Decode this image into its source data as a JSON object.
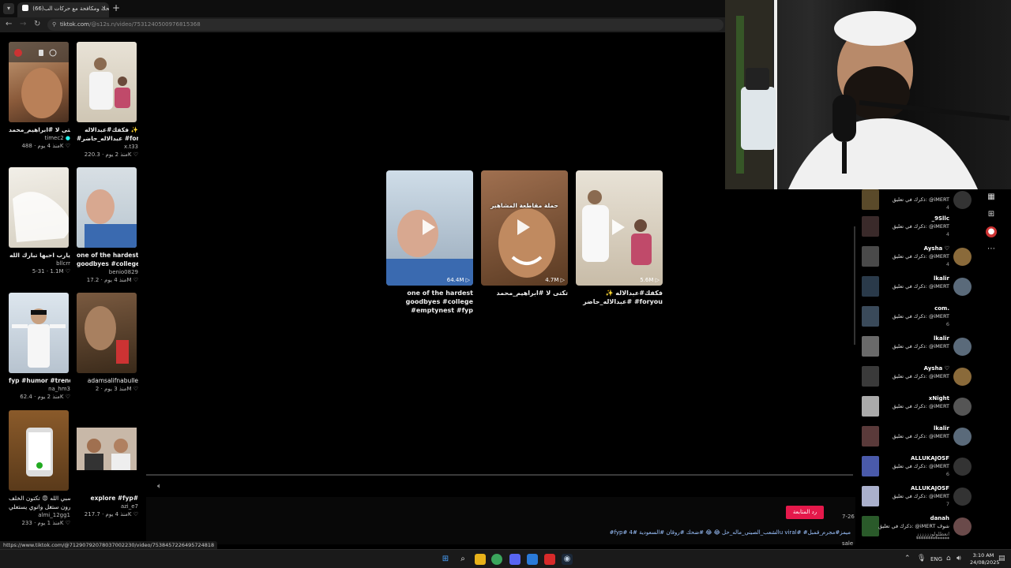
{
  "browser": {
    "tab_title": "(66)الضحك ومكافحة مع حركات الب",
    "tab_close": "×",
    "new_tab": "+",
    "url_domain": "tiktok.com",
    "url_path": "/@s12s.n/video/7531240500976815368",
    "status_url": "https://www.tiktok.com/@71290792078037002230/video/7538457226495724818"
  },
  "left_grid": [
    {
      "caption": "تكتى لا #ابراهيم_محمد",
      "user": "timec2",
      "views": "488K",
      "date": "منذ 4 يوم"
    },
    {
      "caption": "فكفك#عبدالاله ✨",
      "caption2": "#عبدالاله_حاضر #foryou",
      "user": "x.t33",
      "views": "220.3K",
      "date": "منذ 2 يوم"
    },
    {
      "caption": "يارب احبها تبارك الله",
      "user": "bllcrr",
      "views": "1.1M",
      "date": "5-31"
    },
    {
      "caption": "one of the hardest",
      "caption2": "goodbyes #college...",
      "user": "benio0829",
      "views": "17.2M",
      "date": "منذ 4 يوم"
    },
    {
      "caption": "fyp #humor #trend#",
      "user": "na_hm3",
      "views": "62.4K",
      "date": "منذ 2 يوم"
    },
    {
      "caption": "adamsalifnabulle",
      "user": "",
      "views": "2M",
      "date": "منذ 3 يوم"
    },
    {
      "caption": "حسبي الله 😡 تكتون الخلف",
      "caption2": "يحرون ستغل واتوي يستعلي",
      "user": "almi_12gg1",
      "views": "233K",
      "date": "منذ 1 يوم"
    },
    {
      "caption": "explore #fyp#",
      "user": "azi_e7",
      "views": "217.7K",
      "date": "منذ 4 يوم"
    }
  ],
  "related_videos": [
    {
      "caption": "one of the hardest goodbyes #college #emptynest #fyp",
      "views": "64.4M"
    },
    {
      "caption": "تكتى لا #ابراهيم_محمد",
      "views": "4.7M"
    },
    {
      "caption": "فكفك#عبدالاله ✨ #عبدالاله_حاضر #foryou",
      "views": "5.6M"
    }
  ],
  "thumb_overlays": {
    "meme": "حملة مقاطعة المشاهير"
  },
  "video_footer": {
    "reply_button": "رد المتابعة",
    "time": "7-26",
    "hashtags": "#fyp# الشعب_الصيني_ماله_حل 😂 😂 #ضحك #روقان #السعودية #4u viral# #ميمز#مجرم_قمبل",
    "sale": "sale"
  },
  "notifications": [
    {
      "name": "",
      "text": "ذكرك في تعليق: @iMERT",
      "time": "4",
      "thumb": "#5a4a2a",
      "avatar": "#333"
    },
    {
      "name": "_9Sllc",
      "text": "ذكرك في تعليق: @iMERT",
      "time": "4",
      "thumb": "#3a2a2a",
      "avatar": ""
    },
    {
      "name": "Aysha ♡",
      "text": "ذكرك في تعليق: @iMERT",
      "time": "4",
      "thumb": "#4a4a4a",
      "avatar": "#8a6a3a"
    },
    {
      "name": "lkalir",
      "text": "ذكرك في تعليق: @iMERT",
      "time": "6",
      "thumb": "#2a3a4a",
      "avatar": "#5a6a7a"
    },
    {
      "name": "com.",
      "text": "ذكرك في تعليق: @iMERT",
      "time": "6",
      "thumb": "#3a4a5a",
      "avatar": ""
    },
    {
      "name": "lkalir",
      "text": "ذكرك في تعليق: @iMERT",
      "time": "6",
      "thumb": "#6a6a6a",
      "avatar": "#5a6a7a"
    },
    {
      "name": "Aysha ♡",
      "text": "ذكرك في تعليق: @iMERT",
      "time": "6",
      "thumb": "#3a3a3a",
      "avatar": "#8a6a3a"
    },
    {
      "name": "xNight",
      "text": "ذكرك في تعليق: @iMERT",
      "time": "6",
      "thumb": "#aaa",
      "avatar": "#555"
    },
    {
      "name": "lkalir",
      "text": "ذكرك في تعليق: @iMERT",
      "time": "6",
      "thumb": "#5a3a3a",
      "avatar": "#5a6a7a"
    },
    {
      "name": "ALLUKAJOSF",
      "text": "ذكرك في تعليق: @iMERT",
      "time": "6",
      "thumb": "#4a5aaa",
      "avatar": "#333"
    },
    {
      "name": "ALLUKAJOSF",
      "text": "ذكرك في تعليق: @iMERT",
      "time": "7",
      "thumb": "#aab0cc",
      "avatar": "#333"
    },
    {
      "name": "danah",
      "text": "ذكرك في تعليق: @iMERT شوف",
      "time": "انعطلولوزززززز",
      "thumb": "#2a5a2a",
      "avatar": "#6a4a4a"
    }
  ],
  "notif_footer": "**************",
  "taskbar": {
    "lang": "ENG",
    "time": "3:10 AM",
    "date": "24/08/2025"
  },
  "colors": {
    "accent": "#e5194b",
    "link": "#9cc3ff"
  }
}
